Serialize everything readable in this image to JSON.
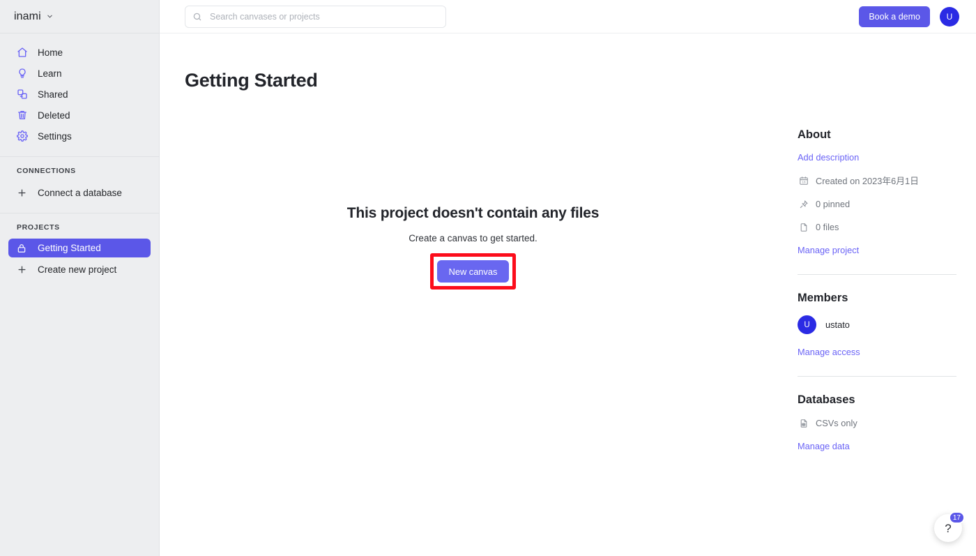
{
  "workspace": {
    "name": "inami",
    "chevron_icon": "chevron-down-icon"
  },
  "sidebar": {
    "nav": [
      {
        "label": "Home",
        "icon": "home-icon"
      },
      {
        "label": "Learn",
        "icon": "lightbulb-icon"
      },
      {
        "label": "Shared",
        "icon": "shared-icon"
      },
      {
        "label": "Deleted",
        "icon": "trash-icon"
      },
      {
        "label": "Settings",
        "icon": "gear-icon"
      }
    ],
    "connections": {
      "title": "CONNECTIONS",
      "add_label": "Connect a database",
      "add_icon": "plus-icon"
    },
    "projects": {
      "title": "PROJECTS",
      "items": [
        {
          "label": "Getting Started",
          "icon": "lock-icon",
          "active": true
        }
      ],
      "create_label": "Create new project",
      "create_icon": "plus-icon"
    }
  },
  "topbar": {
    "search": {
      "placeholder": "Search canvases or projects",
      "value": "",
      "icon": "search-icon"
    },
    "demo_button": "Book a demo",
    "avatar_initial": "U"
  },
  "page": {
    "title": "Getting Started",
    "empty_state": {
      "title": "This project doesn't contain any files",
      "subtitle": "Create a canvas to get started.",
      "button_label": "New canvas",
      "highlight_color": "#fc0d1b"
    }
  },
  "about": {
    "heading": "About",
    "add_description": "Add description",
    "rows": [
      {
        "icon": "calendar-icon",
        "text": "Created on 2023年6月1日"
      },
      {
        "icon": "pin-icon",
        "text": "0 pinned"
      },
      {
        "icon": "file-icon",
        "text": "0 files"
      }
    ],
    "manage_link": "Manage project"
  },
  "members": {
    "heading": "Members",
    "list": [
      {
        "initial": "U",
        "name": "ustato"
      }
    ],
    "manage_link": "Manage access"
  },
  "databases": {
    "heading": "Databases",
    "rows": [
      {
        "icon": "csv-file-icon",
        "text": "CSVs only"
      }
    ],
    "manage_link": "Manage data"
  },
  "help": {
    "icon": "question-mark-icon",
    "badge": "17"
  },
  "colors": {
    "accent": "#5b57e8",
    "accent_light": "#6967f0",
    "avatar": "#2b2be4",
    "link": "#6a63f6"
  }
}
